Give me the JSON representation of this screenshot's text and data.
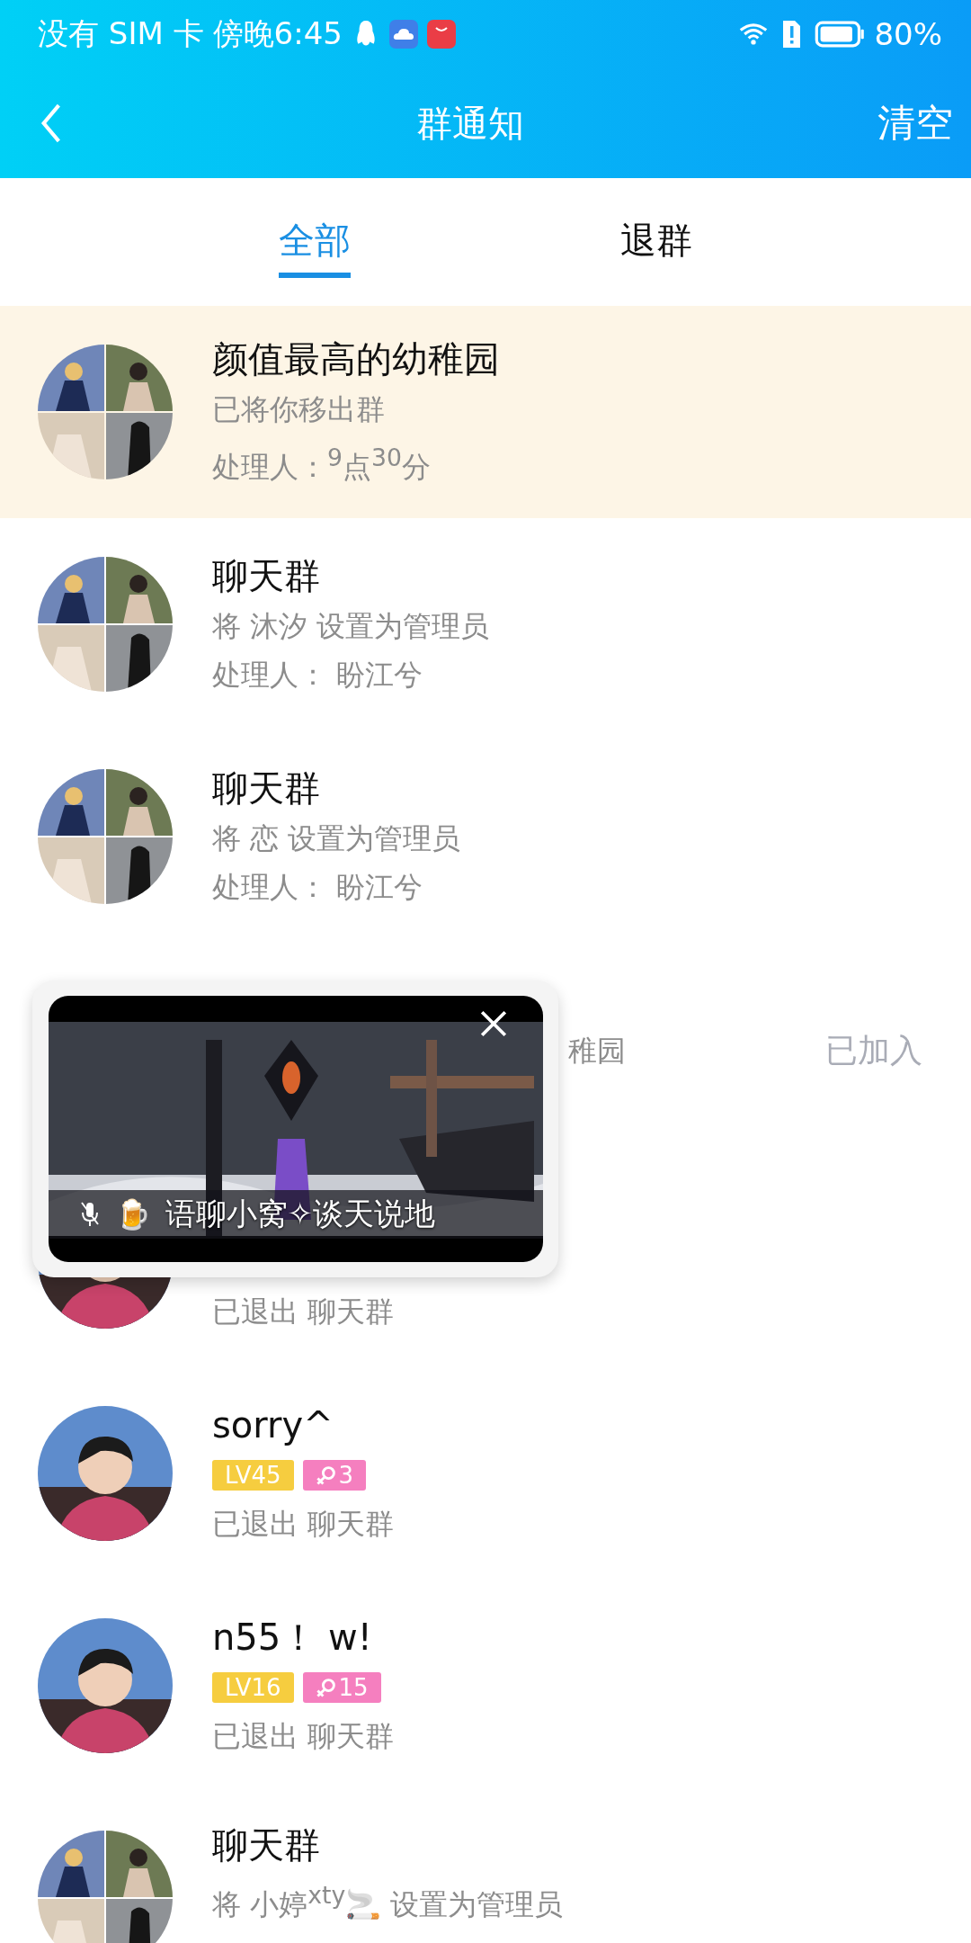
{
  "status_bar": {
    "carrier": "没有 SIM 卡",
    "time": "傍晚6:45",
    "battery": "80%"
  },
  "nav": {
    "title": "群通知",
    "action": "清空"
  },
  "tabs": [
    {
      "label": "全部",
      "selected": true
    },
    {
      "label": "退群",
      "selected": false
    }
  ],
  "notifications": [
    {
      "kind": "group",
      "highlighted": true,
      "title": "颜值最高的幼稚园",
      "subtitle": "已将你移出群",
      "handler": "处理人：$^{9}$点$^{30}$分"
    },
    {
      "kind": "group",
      "highlighted": false,
      "title": "聊天群",
      "subtitle": "将 沐汐 设置为管理员",
      "handler": "处理人： 盼江兮"
    },
    {
      "kind": "group",
      "highlighted": false,
      "title": "聊天群",
      "subtitle": "将 恋 设置为管理员",
      "handler": "处理人： 盼江兮"
    },
    {
      "kind": "none",
      "highlighted": false,
      "obscured": true,
      "subtitle": "稚园",
      "status": "已加入"
    },
    {
      "kind": "person",
      "highlighted": false,
      "obscured": true,
      "handler": "已退出 聊天群"
    },
    {
      "kind": "person",
      "highlighted": false,
      "title": "sorry^",
      "badges": [
        {
          "kind": "level",
          "text": "LV45"
        },
        {
          "kind": "female",
          "text": "3"
        }
      ],
      "handler": "已退出 聊天群"
    },
    {
      "kind": "person",
      "highlighted": false,
      "title": "n55！ w!",
      "badges": [
        {
          "kind": "level",
          "text": "LV16"
        },
        {
          "kind": "female",
          "text": "15"
        }
      ],
      "handler": "已退出 聊天群"
    },
    {
      "kind": "group",
      "highlighted": false,
      "title": "聊天群",
      "subtitle": "将 小婷$^{xty}$🚬 设置为管理员"
    }
  ],
  "floating_video": {
    "kind": "picture",
    "caption": "语聊小窝✧谈天说地",
    "emoji": "🍺"
  }
}
